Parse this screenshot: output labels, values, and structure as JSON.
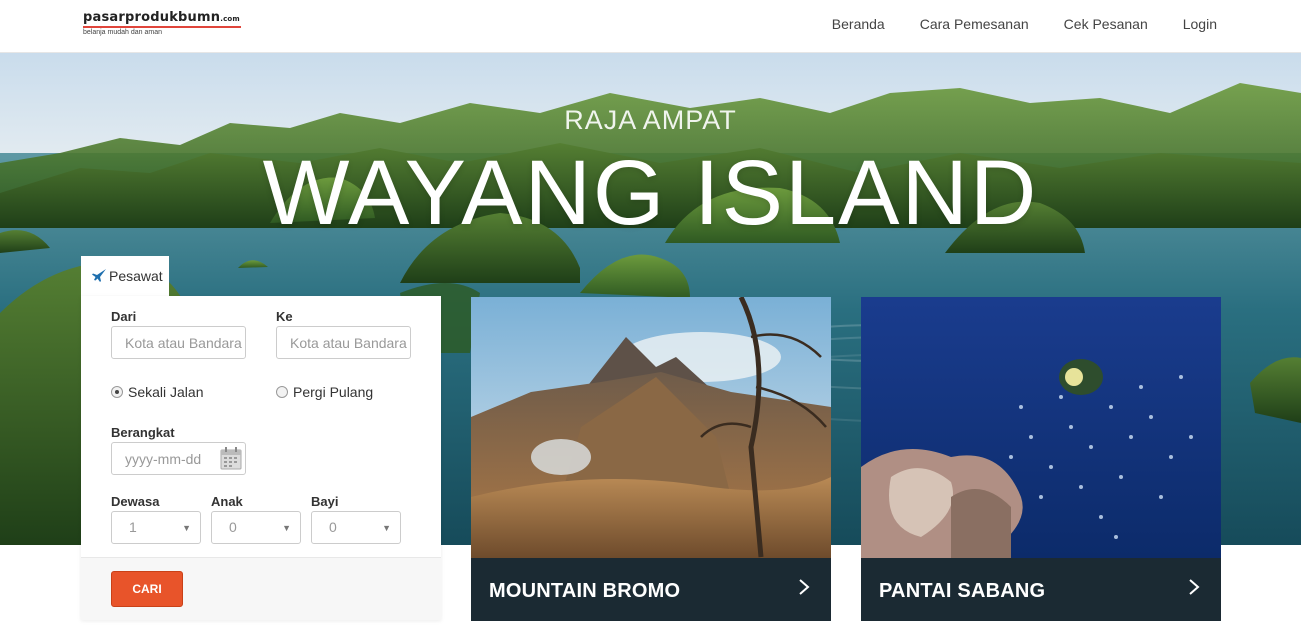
{
  "header": {
    "logo": {
      "main": "pasarprodukbumn",
      "suffix": ".com",
      "tagline": "belanja mudah dan aman"
    },
    "nav": [
      "Beranda",
      "Cara Pemesanan",
      "Cek Pesanan",
      "Login"
    ]
  },
  "hero": {
    "subtitle": "RAJA AMPAT",
    "title": "WAYANG ISLAND"
  },
  "search": {
    "tab": {
      "label": "Pesawat",
      "icon": "airplane-icon"
    },
    "from": {
      "label": "Dari",
      "placeholder": "Kota atau Bandara"
    },
    "to": {
      "label": "Ke",
      "placeholder": "Kota atau Bandara"
    },
    "trip_options": [
      {
        "label": "Sekali Jalan",
        "selected": true
      },
      {
        "label": "Pergi Pulang",
        "selected": false
      }
    ],
    "depart": {
      "label": "Berangkat",
      "placeholder": "yyyy-mm-dd",
      "icon": "calendar-icon"
    },
    "passengers": [
      {
        "label": "Dewasa",
        "value": "1"
      },
      {
        "label": "Anak",
        "value": "0"
      },
      {
        "label": "Bayi",
        "value": "0"
      }
    ],
    "submit_label": "CARI",
    "accent_color": "#e8542a"
  },
  "cards": [
    {
      "title": "MOUNTAIN BROMO",
      "icon": "chevron-right-icon"
    },
    {
      "title": "PANTAI SABANG",
      "icon": "chevron-right-icon"
    }
  ]
}
